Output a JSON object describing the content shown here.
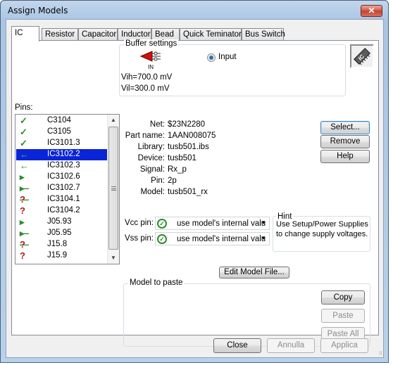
{
  "window": {
    "title": "Assign Models",
    "close_glyph": "✕"
  },
  "tabs": [
    {
      "label": "IC",
      "active": true
    },
    {
      "label": "Resistor"
    },
    {
      "label": "Capacitor"
    },
    {
      "label": "Inductor"
    },
    {
      "label": "Bead"
    },
    {
      "label": "Quick Teminator"
    },
    {
      "label": "Bus Switch"
    }
  ],
  "buffer": {
    "group_label": "Buffer settings",
    "symbol_label": "IN",
    "vih": "Vih=700.0 mV",
    "vil": "Vil=300.0 mV",
    "radio_label": "Input",
    "radio_selected": true
  },
  "pins": {
    "label": "Pins:",
    "items": [
      {
        "name": "C3104",
        "status": "assigned",
        "icon": "check"
      },
      {
        "name": "C3105",
        "status": "assigned",
        "icon": "check"
      },
      {
        "name": "IC3101.3",
        "status": "assigned",
        "icon": "check"
      },
      {
        "name": "IC3102.2",
        "status": "input",
        "icon": "arrow-left",
        "selected": true
      },
      {
        "name": "IC3102.3",
        "status": "input",
        "icon": "arrow-left"
      },
      {
        "name": "IC3102.6",
        "status": "output",
        "icon": "arrow-right"
      },
      {
        "name": "IC3102.7",
        "status": "output",
        "icon": "arrow-right"
      },
      {
        "name": "IC3104.1",
        "status": "unassigned",
        "icon": "question"
      },
      {
        "name": "IC3104.2",
        "status": "unassigned",
        "icon": "question"
      },
      {
        "name": "J05.93",
        "status": "output",
        "icon": "arrow-right"
      },
      {
        "name": "J05.95",
        "status": "output",
        "icon": "arrow-right"
      },
      {
        "name": "J15.8",
        "status": "unassigned",
        "icon": "question"
      },
      {
        "name": "J15.9",
        "status": "unassigned",
        "icon": "question"
      }
    ]
  },
  "details": {
    "net_label": "Net:",
    "net": "$23N2280",
    "part_label": "Part name:",
    "part": "1AAN008075",
    "library_label": "Library:",
    "library": "tusb501.ibs",
    "device_label": "Device:",
    "device": "tusb501",
    "signal_label": "Signal:",
    "signal": "Rx_p",
    "pin_label": "Pin:",
    "pin": "2p",
    "model_label": "Model:",
    "model": "tusb501_rx"
  },
  "actions": {
    "select": "Select...",
    "remove": "Remove",
    "help": "Help"
  },
  "supply": {
    "vcc_label": "Vcc pin:",
    "vcc_value": "use model's internal valu",
    "vss_label": "Vss pin:",
    "vss_value": "use model's internal valu",
    "hint_label": "Hint",
    "hint_line1": "Use Setup/Power Supplies",
    "hint_line2": "to change supply voltages."
  },
  "edit_model": "Edit Model File...",
  "paste_group": {
    "label": "Model to paste",
    "copy": "Copy",
    "paste": "Paste",
    "paste_all": "Paste All"
  },
  "footer": {
    "close": "Close",
    "cancel": "Annulla",
    "apply": "Applica"
  },
  "colors": {
    "selection": "#0a24d8",
    "check": "#2b8c2b",
    "question": "#b01818"
  }
}
